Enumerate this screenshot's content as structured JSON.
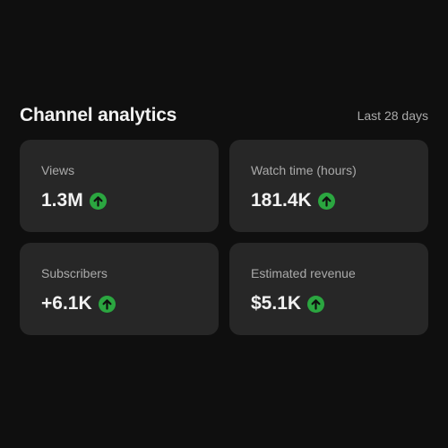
{
  "header": {
    "title": "Channel analytics",
    "period": "Last 28 days"
  },
  "metrics": [
    {
      "label": "Views",
      "value": "1.3M",
      "trend": "arrow-up-icon"
    },
    {
      "label": "Watch time (hours)",
      "value": "181.4K",
      "trend": "arrow-up-icon"
    },
    {
      "label": "Subscribers",
      "value": "+6.1K",
      "trend": "arrow-up-icon"
    },
    {
      "label": "Estimated revenue",
      "value": "$5.1K",
      "trend": "arrow-up-icon"
    }
  ],
  "colors": {
    "background": "#0f0f0f",
    "card": "#272727",
    "positive": "#2ba640"
  }
}
